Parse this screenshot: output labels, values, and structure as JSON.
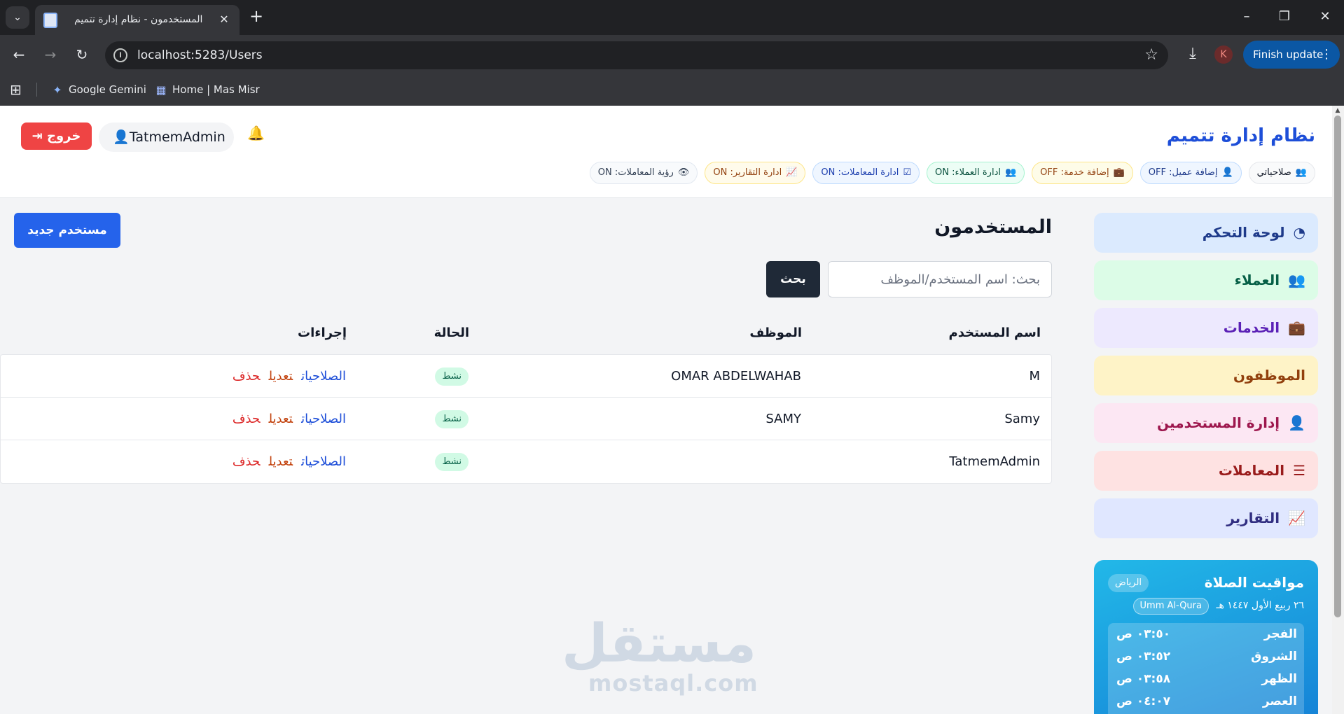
{
  "browser": {
    "tab_title": "المستخدمون - نظام إدارة تتميم",
    "url": "localhost:5283/Users",
    "finish_update": "Finish update",
    "profile_initial": "K",
    "bookmarks": [
      {
        "label": "Google Gemini",
        "icon": "gemini-icon"
      },
      {
        "label": "Home | Mas Misr",
        "icon": "mas-misr-icon"
      }
    ]
  },
  "header": {
    "brand": "نظام إدارة تتميم",
    "username": "TatmemAdmin",
    "logout": "خروج",
    "permissions": [
      {
        "label": "صلاحياتي",
        "icon": "user-gear-icon"
      },
      {
        "label": "إضافة عميل: OFF",
        "icon": "user-plus-icon"
      },
      {
        "label": "إضافة خدمة: OFF",
        "icon": "briefcase-icon"
      },
      {
        "label": "ادارة العملاء: ON",
        "icon": "users-gear-icon"
      },
      {
        "label": "ادارة المعاملات: ON",
        "icon": "list-check-icon"
      },
      {
        "label": "ادارة التقارير: ON",
        "icon": "chart-line-icon"
      },
      {
        "label": "رؤية المعاملات: ON",
        "icon": "eye-icon"
      }
    ]
  },
  "sidebar": {
    "items": [
      {
        "label": "لوحة التحكم",
        "icon": "dashboard-icon"
      },
      {
        "label": "العملاء",
        "icon": "users-icon"
      },
      {
        "label": "الخدمات",
        "icon": "briefcase-icon"
      },
      {
        "label": "الموظفون",
        "icon": ""
      },
      {
        "label": "إدارة المستخدمين",
        "icon": "user-gear-icon"
      },
      {
        "label": "المعاملات",
        "icon": "list-check-icon"
      },
      {
        "label": "التقارير",
        "icon": "chart-line-icon"
      }
    ]
  },
  "prayer": {
    "title": "مواقيت الصلاة",
    "city": "الرياض",
    "hijri_date": "٢٦ ربيع الأول ١٤٤٧ هـ",
    "calendar": "Umm Al-Qura",
    "times": [
      {
        "name": "الفجر",
        "time": "٠٣:٥٠ ص"
      },
      {
        "name": "الشروق",
        "time": "٠٣:٥٢ ص"
      },
      {
        "name": "الظهر",
        "time": "٠٣:٥٨ ص"
      },
      {
        "name": "العصر",
        "time": "٠٤:٠٧ ص"
      }
    ]
  },
  "main": {
    "title": "المستخدمون",
    "new_user": "مستخدم جديد",
    "search_placeholder": "بحث: اسم المستخدم/الموظف",
    "search_button": "بحث",
    "columns": [
      "اسم المستخدم",
      "الموظف",
      "الحالة",
      "إجراءات"
    ],
    "rows": [
      {
        "username": "M",
        "employee": "OMAR ABDELWAHAB",
        "status": "نشط"
      },
      {
        "username": "Samy",
        "employee": "SAMY",
        "status": "نشط"
      },
      {
        "username": "TatmemAdmin",
        "employee": "",
        "status": "نشط"
      }
    ],
    "actions": {
      "permissions": "الصلاحيات",
      "edit": "تعديل",
      "delete": "حذف"
    }
  },
  "watermark": {
    "arabic": "مستقل",
    "latin": "mostaql.com"
  }
}
